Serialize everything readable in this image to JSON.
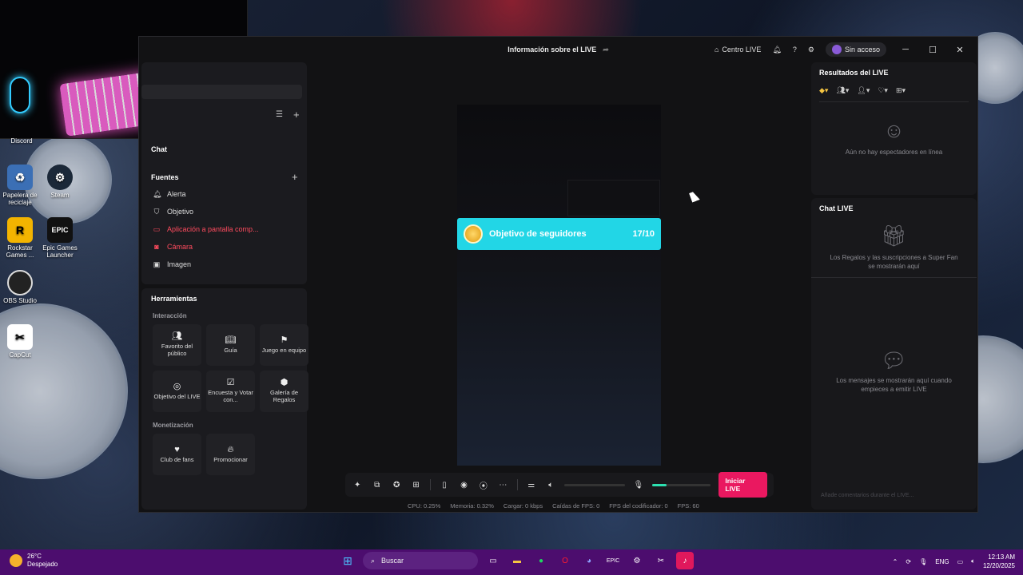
{
  "window": {
    "title": "Información sobre el LIVE",
    "centro_live": "Centro LIVE",
    "account": "Sin acceso"
  },
  "desktop": {
    "icons": [
      "Discord",
      "Papelera de reciclaje",
      "Steam",
      "Rockstar Games ...",
      "Epic Games Launcher",
      "OBS Studio",
      "CapCut"
    ]
  },
  "left": {
    "chat": "Chat",
    "sources_title": "Fuentes",
    "sources": [
      {
        "label": "Alerta",
        "icon": "bell-icon",
        "error": false
      },
      {
        "label": "Objetivo",
        "icon": "shield-icon",
        "error": false
      },
      {
        "label": "Aplicación a pantalla comp...",
        "icon": "screen-icon",
        "error": true
      },
      {
        "label": "Cámara",
        "icon": "camera-icon",
        "error": true
      },
      {
        "label": "Imagen",
        "icon": "image-icon",
        "error": false
      }
    ],
    "tools_title": "Herramientas",
    "interaction_title": "Interacción",
    "interaction_tools": [
      "Favorito del público",
      "Guía",
      "Juego en equipo",
      "Objetivo del LIVE",
      "Encuesta y Votar con...",
      "Galería de Regalos"
    ],
    "monetization_title": "Monetización",
    "monetization_tools": [
      "Club de fans",
      "Promocionar"
    ]
  },
  "preview": {
    "goal_label": "Objetivo de seguidores",
    "goal_count": "17/10"
  },
  "controls": {
    "go_live": "Iniciar LIVE",
    "volume_level": 0.0,
    "mic_level": 0.25
  },
  "stats": {
    "cpu": "CPU: 0.25%",
    "memory": "Memoria: 0.32%",
    "upload": "Cargar: 0 kbps",
    "fps_drops": "Caídas de FPS: 0",
    "encoder_fps": "FPS del codificador: 0",
    "fps": "FPS: 60"
  },
  "right": {
    "results_title": "Resultados del LIVE",
    "no_viewers": "Aún no hay espectadores en línea",
    "chat_title": "Chat LIVE",
    "gifts_note": "Los Regalos y las suscripciones a Super Fan se mostrarán aquí",
    "messages_note": "Los mensajes se mostrarán aquí cuando empieces a emitir LIVE",
    "chat_placeholder": "Añade comentarios durante el LIVE..."
  },
  "taskbar": {
    "temp": "26°C",
    "weather": "Despejado",
    "search": "Buscar",
    "lang": "ENG",
    "time": "12:13 AM",
    "date": "12/20/2025"
  }
}
